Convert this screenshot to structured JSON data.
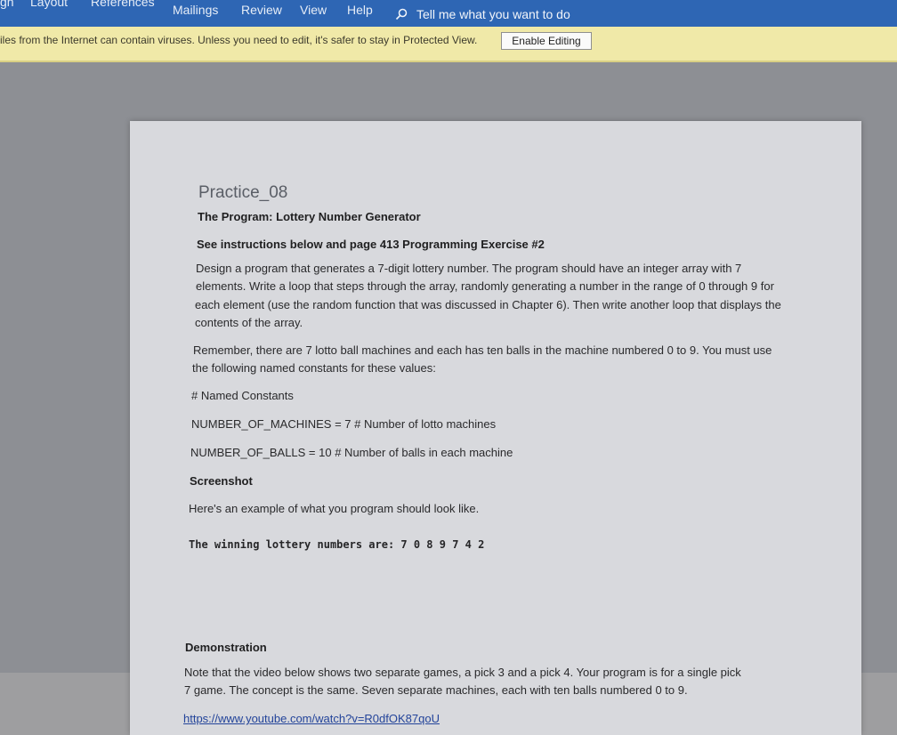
{
  "ribbon": {
    "tabs": [
      {
        "id": "design",
        "label": "gn"
      },
      {
        "id": "layout",
        "label": "Layout"
      },
      {
        "id": "references",
        "label": "References"
      },
      {
        "id": "mailings",
        "label": "Mailings"
      },
      {
        "id": "review",
        "label": "Review"
      },
      {
        "id": "view",
        "label": "View"
      },
      {
        "id": "help",
        "label": "Help"
      }
    ],
    "tell_me": "Tell me what you want to do",
    "tell_me_icon": "search-icon"
  },
  "protected_bar": {
    "message": "iles from the Internet can contain viruses. Unless you need to edit, it's safer to stay in Protected View.",
    "button": "Enable Editing"
  },
  "document": {
    "title": "Practice_08",
    "program_line": "The Program:  Lottery Number Generator",
    "instructions_line": "See instructions below and page 413 Programming Exercise #2",
    "paragraph1": [
      "Design a program that generates a 7-digit lottery number. The program should have an integer array with 7",
      "elements. Write a loop that steps through the array, randomly generating a number in the range of 0 through 9 for",
      "each element (use the random function that was discussed in Chapter 6). Then write another loop that displays the",
      "contents of the array."
    ],
    "paragraph2": [
      "Remember, there are 7 lotto ball machines and each has ten balls in the machine numbered 0 to 9. You must use",
      "the following named constants for these values:"
    ],
    "named_constants_heading": "# Named Constants",
    "constant_machines": "NUMBER_OF_MACHINES = 7  # Number of lotto machines",
    "constant_balls": "NUMBER_OF_BALLS = 10    # Number of balls in each machine",
    "screenshot_heading": "Screenshot",
    "example_text": "Here's an example of what you program should look like.",
    "code_output": "The winning lottery numbers are: 7 0 8 9 7 4 2",
    "demonstration_heading": "Demonstration",
    "demo_paragraph": [
      "Note that the video below shows two separate games, a pick 3 and a pick 4. Your program is for a single pick",
      "7 game. The concept is the same. Seven separate machines, each with ten balls numbered 0 to 9."
    ],
    "link": "https://www.youtube.com/watch?v=R0dfOK87qoU"
  }
}
